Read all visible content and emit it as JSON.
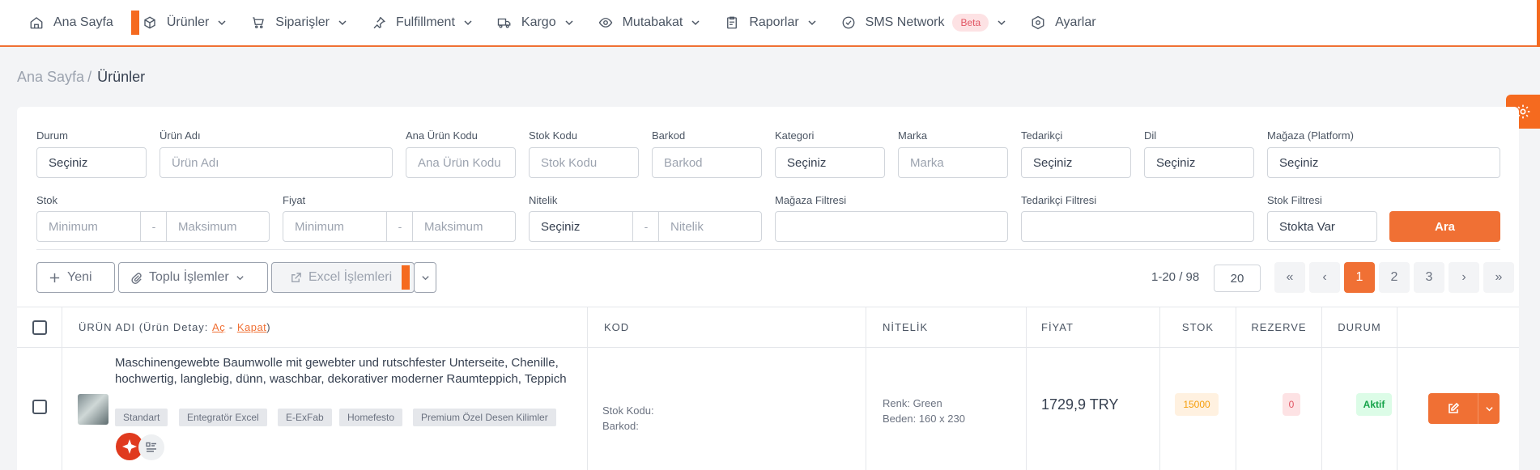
{
  "nav": {
    "items": [
      {
        "label": "Ana Sayfa",
        "icon": "home-icon"
      },
      {
        "label": "Ürünler",
        "icon": "box-icon"
      },
      {
        "label": "Siparişler",
        "icon": "cart-icon"
      },
      {
        "label": "Fulfillment",
        "icon": "pin-icon"
      },
      {
        "label": "Kargo",
        "icon": "truck-icon"
      },
      {
        "label": "Mutabakat",
        "icon": "eye-icon"
      },
      {
        "label": "Raporlar",
        "icon": "clipboard-icon"
      },
      {
        "label": "SMS Network",
        "icon": "check-circle-icon",
        "badge": "Beta"
      },
      {
        "label": "Ayarlar",
        "icon": "hexagon-settings-icon"
      }
    ]
  },
  "breadcrumb": {
    "home": "Ana Sayfa",
    "sep": "/",
    "current": "Ürünler"
  },
  "filters": {
    "durum": {
      "label": "Durum",
      "value": "Seçiniz"
    },
    "urun_adi": {
      "label": "Ürün Adı",
      "placeholder": "Ürün Adı"
    },
    "ana_urun_kodu": {
      "label": "Ana Ürün Kodu",
      "placeholder": "Ana Ürün Kodu"
    },
    "stok_kodu": {
      "label": "Stok Kodu",
      "placeholder": "Stok Kodu"
    },
    "barkod": {
      "label": "Barkod",
      "placeholder": "Barkod"
    },
    "kategori": {
      "label": "Kategori",
      "value": "Seçiniz"
    },
    "marka": {
      "label": "Marka",
      "placeholder": "Marka"
    },
    "tedarikci": {
      "label": "Tedarikçi",
      "value": "Seçiniz"
    },
    "dil": {
      "label": "Dil",
      "value": "Seçiniz"
    },
    "magaza": {
      "label": "Mağaza (Platform)",
      "value": "Seçiniz"
    },
    "stok": {
      "label": "Stok",
      "min": "Minimum",
      "max": "Maksimum",
      "sep": "-"
    },
    "fiyat": {
      "label": "Fiyat",
      "min": "Minimum",
      "max": "Maksimum",
      "sep": "-"
    },
    "nitelik": {
      "label": "Nitelik",
      "value": "Seçiniz",
      "placeholder": "Nitelik",
      "sep": "-"
    },
    "magaza_filtresi": {
      "label": "Mağaza Filtresi",
      "value": ""
    },
    "tedarikci_filtresi": {
      "label": "Tedarikçi Filtresi",
      "value": ""
    },
    "stok_filtresi": {
      "label": "Stok Filtresi",
      "value": "Stokta Var"
    },
    "search_button": "Ara"
  },
  "toolbar": {
    "new_label": "Yeni",
    "bulk_label": "Toplu İşlemler",
    "excel_label": "Excel İşlemleri"
  },
  "pagination": {
    "info": "1-20 / 98",
    "page_size": "20",
    "first": "«",
    "prev": "‹",
    "pages": [
      "1",
      "2",
      "3"
    ],
    "active_page": "1",
    "next": "›",
    "last": "»"
  },
  "table": {
    "headers": {
      "urun_adi": "ÜRÜN ADI (Ürün Detay:",
      "ac": "Aç",
      "dash": "-",
      "kapat": "Kapat",
      "close_paren": ")",
      "kod": "KOD",
      "nitelik": "NİTELİK",
      "fiyat": "FİYAT",
      "stok": "STOK",
      "rezerve": "REZERVE",
      "durum": "DURUM"
    },
    "rows": [
      {
        "name": "Maschinengewebte Baumwolle mit gewebter und rutschfester Unterseite, Chenille, hochwertig, langlebig, dünn, waschbar, dekorativer moderner Raumteppich, Teppich",
        "tags": [
          "Standart",
          "Entegratör Excel",
          "E-ExFab",
          "Homefesto",
          "Premium Özel Desen Kilimler"
        ],
        "stok_kodu": "Stok Kodu:",
        "barkod": "Barkod:",
        "nitelik_renk": "Renk: Green",
        "nitelik_beden": "Beden: 160 x 230",
        "fiyat": "1729,9 TRY",
        "stok": "15000",
        "rezerve": "0",
        "durum": "Aktif"
      }
    ]
  },
  "colors": {
    "accent": "#f07034",
    "marker": "#f56a1f",
    "stock_bg": "#fff1e0",
    "stock_fg": "#f59e0b",
    "reserve_bg": "#fde2e4",
    "reserve_fg": "#e15563",
    "active_bg": "#dcfce7",
    "active_fg": "#16a34a"
  }
}
